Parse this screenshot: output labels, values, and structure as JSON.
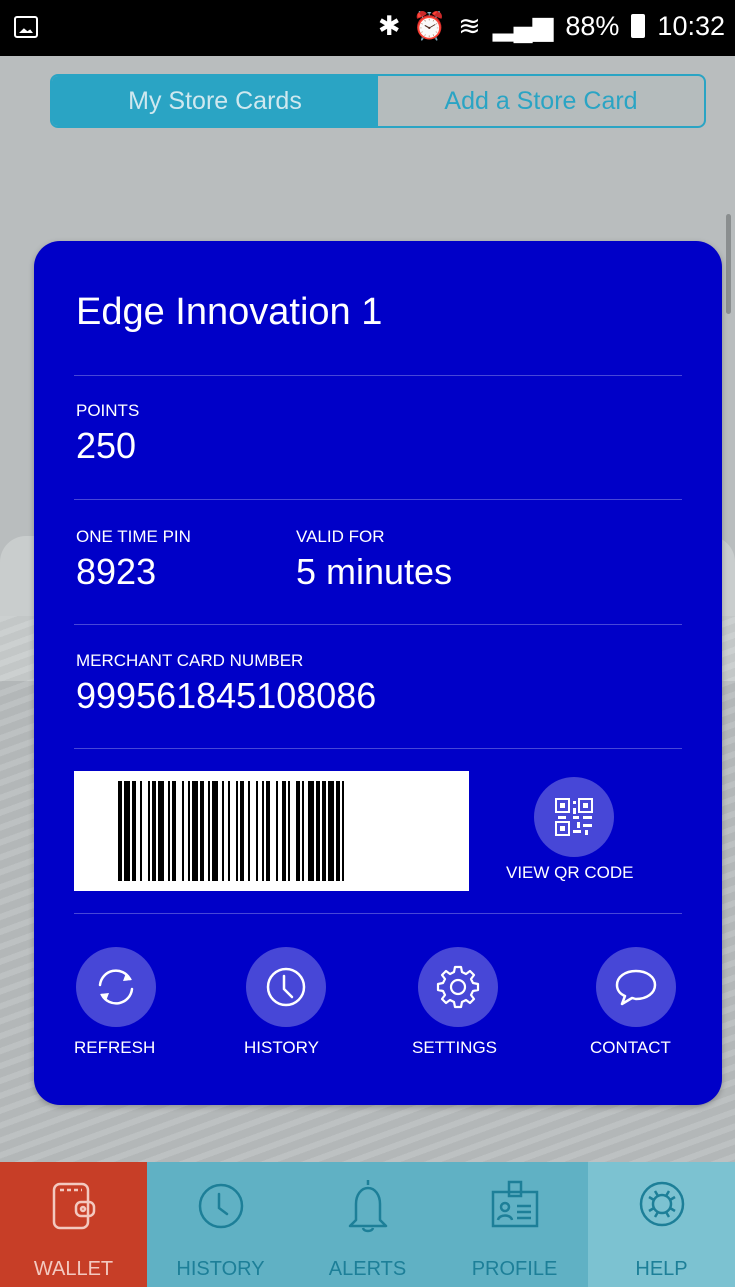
{
  "status_bar": {
    "battery": "88%",
    "time": "10:32"
  },
  "segment": {
    "tab_my_cards": "My Store Cards",
    "tab_add_card": "Add a Store Card"
  },
  "card": {
    "title": "Edge Innovation 1",
    "points_label": "POINTS",
    "points_value": "250",
    "otp_label": "ONE TIME PIN",
    "otp_value": "8923",
    "valid_label": "VALID FOR",
    "valid_value": "5 minutes",
    "merchant_label": "MERCHANT CARD NUMBER",
    "merchant_value": "999561845108086",
    "qr_label": "VIEW QR CODE",
    "bg_color": "#0000c8"
  },
  "actions": [
    {
      "label": "REFRESH",
      "icon": "refresh-icon"
    },
    {
      "label": "HISTORY",
      "icon": "clock-icon"
    },
    {
      "label": "SETTINGS",
      "icon": "gear-icon"
    },
    {
      "label": "CONTACT",
      "icon": "chat-bubble-icon"
    }
  ],
  "nav": [
    {
      "label": "WALLET",
      "icon": "wallet-icon",
      "active": true
    },
    {
      "label": "HISTORY",
      "icon": "clock-icon"
    },
    {
      "label": "ALERTS",
      "icon": "bell-icon"
    },
    {
      "label": "PROFILE",
      "icon": "id-card-icon"
    },
    {
      "label": "HELP",
      "icon": "lifebuoy-icon"
    }
  ],
  "colors": {
    "accent": "#2aa4c4",
    "nav_bg": "#60b1c4",
    "nav_active": "#c73e27"
  }
}
